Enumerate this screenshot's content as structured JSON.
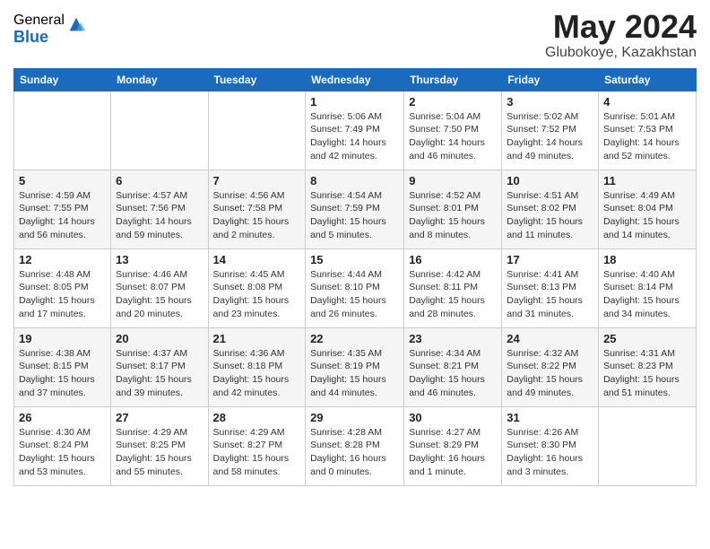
{
  "logo": {
    "general": "General",
    "blue": "Blue"
  },
  "title": {
    "month_year": "May 2024",
    "location": "Glubokoye, Kazakhstan"
  },
  "weekdays": [
    "Sunday",
    "Monday",
    "Tuesday",
    "Wednesday",
    "Thursday",
    "Friday",
    "Saturday"
  ],
  "weeks": [
    [
      {
        "day": "",
        "info": ""
      },
      {
        "day": "",
        "info": ""
      },
      {
        "day": "",
        "info": ""
      },
      {
        "day": "1",
        "info": "Sunrise: 5:06 AM\nSunset: 7:49 PM\nDaylight: 14 hours\nand 42 minutes."
      },
      {
        "day": "2",
        "info": "Sunrise: 5:04 AM\nSunset: 7:50 PM\nDaylight: 14 hours\nand 46 minutes."
      },
      {
        "day": "3",
        "info": "Sunrise: 5:02 AM\nSunset: 7:52 PM\nDaylight: 14 hours\nand 49 minutes."
      },
      {
        "day": "4",
        "info": "Sunrise: 5:01 AM\nSunset: 7:53 PM\nDaylight: 14 hours\nand 52 minutes."
      }
    ],
    [
      {
        "day": "5",
        "info": "Sunrise: 4:59 AM\nSunset: 7:55 PM\nDaylight: 14 hours\nand 56 minutes."
      },
      {
        "day": "6",
        "info": "Sunrise: 4:57 AM\nSunset: 7:56 PM\nDaylight: 14 hours\nand 59 minutes."
      },
      {
        "day": "7",
        "info": "Sunrise: 4:56 AM\nSunset: 7:58 PM\nDaylight: 15 hours\nand 2 minutes."
      },
      {
        "day": "8",
        "info": "Sunrise: 4:54 AM\nSunset: 7:59 PM\nDaylight: 15 hours\nand 5 minutes."
      },
      {
        "day": "9",
        "info": "Sunrise: 4:52 AM\nSunset: 8:01 PM\nDaylight: 15 hours\nand 8 minutes."
      },
      {
        "day": "10",
        "info": "Sunrise: 4:51 AM\nSunset: 8:02 PM\nDaylight: 15 hours\nand 11 minutes."
      },
      {
        "day": "11",
        "info": "Sunrise: 4:49 AM\nSunset: 8:04 PM\nDaylight: 15 hours\nand 14 minutes."
      }
    ],
    [
      {
        "day": "12",
        "info": "Sunrise: 4:48 AM\nSunset: 8:05 PM\nDaylight: 15 hours\nand 17 minutes."
      },
      {
        "day": "13",
        "info": "Sunrise: 4:46 AM\nSunset: 8:07 PM\nDaylight: 15 hours\nand 20 minutes."
      },
      {
        "day": "14",
        "info": "Sunrise: 4:45 AM\nSunset: 8:08 PM\nDaylight: 15 hours\nand 23 minutes."
      },
      {
        "day": "15",
        "info": "Sunrise: 4:44 AM\nSunset: 8:10 PM\nDaylight: 15 hours\nand 26 minutes."
      },
      {
        "day": "16",
        "info": "Sunrise: 4:42 AM\nSunset: 8:11 PM\nDaylight: 15 hours\nand 28 minutes."
      },
      {
        "day": "17",
        "info": "Sunrise: 4:41 AM\nSunset: 8:13 PM\nDaylight: 15 hours\nand 31 minutes."
      },
      {
        "day": "18",
        "info": "Sunrise: 4:40 AM\nSunset: 8:14 PM\nDaylight: 15 hours\nand 34 minutes."
      }
    ],
    [
      {
        "day": "19",
        "info": "Sunrise: 4:38 AM\nSunset: 8:15 PM\nDaylight: 15 hours\nand 37 minutes."
      },
      {
        "day": "20",
        "info": "Sunrise: 4:37 AM\nSunset: 8:17 PM\nDaylight: 15 hours\nand 39 minutes."
      },
      {
        "day": "21",
        "info": "Sunrise: 4:36 AM\nSunset: 8:18 PM\nDaylight: 15 hours\nand 42 minutes."
      },
      {
        "day": "22",
        "info": "Sunrise: 4:35 AM\nSunset: 8:19 PM\nDaylight: 15 hours\nand 44 minutes."
      },
      {
        "day": "23",
        "info": "Sunrise: 4:34 AM\nSunset: 8:21 PM\nDaylight: 15 hours\nand 46 minutes."
      },
      {
        "day": "24",
        "info": "Sunrise: 4:32 AM\nSunset: 8:22 PM\nDaylight: 15 hours\nand 49 minutes."
      },
      {
        "day": "25",
        "info": "Sunrise: 4:31 AM\nSunset: 8:23 PM\nDaylight: 15 hours\nand 51 minutes."
      }
    ],
    [
      {
        "day": "26",
        "info": "Sunrise: 4:30 AM\nSunset: 8:24 PM\nDaylight: 15 hours\nand 53 minutes."
      },
      {
        "day": "27",
        "info": "Sunrise: 4:29 AM\nSunset: 8:25 PM\nDaylight: 15 hours\nand 55 minutes."
      },
      {
        "day": "28",
        "info": "Sunrise: 4:29 AM\nSunset: 8:27 PM\nDaylight: 15 hours\nand 58 minutes."
      },
      {
        "day": "29",
        "info": "Sunrise: 4:28 AM\nSunset: 8:28 PM\nDaylight: 16 hours\nand 0 minutes."
      },
      {
        "day": "30",
        "info": "Sunrise: 4:27 AM\nSunset: 8:29 PM\nDaylight: 16 hours\nand 1 minute."
      },
      {
        "day": "31",
        "info": "Sunrise: 4:26 AM\nSunset: 8:30 PM\nDaylight: 16 hours\nand 3 minutes."
      },
      {
        "day": "",
        "info": ""
      }
    ]
  ]
}
